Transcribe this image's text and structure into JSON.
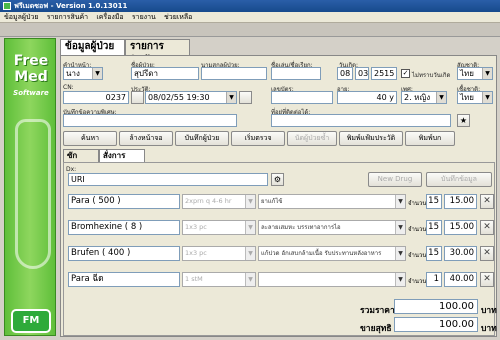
{
  "window": {
    "title": "ฟรีเมดซอฟ - Version 1.0.13011"
  },
  "menu": [
    "ข้อมูลผู้ป่วย",
    "รายการสินค้า",
    "เครื่องมือ",
    "รายงาน",
    "ช่วยเหลือ"
  ],
  "sidebar": {
    "logo_line1": "Free",
    "logo_line2": "Med",
    "logo_line3": "Software",
    "badge": "FM"
  },
  "tabs": {
    "patient": "ข้อมูลผู้ป่วย",
    "products": "รายการสินค้า"
  },
  "patient": {
    "prefix_label": "คำนำหน้า:",
    "prefix": "นาง",
    "firstname_label": "ชื่อผู้ป่วย:",
    "firstname": "สุปรีดา",
    "lastname_label": "นามสกุลผู้ป่วย:",
    "lastname": "",
    "nickname_label": "ชื่อเล่น/ชื่อเรียก:",
    "nickname": "",
    "birthdate_label": "วันเกิด:",
    "birth_day": "08",
    "birth_month": "03",
    "birth_year": "2515",
    "unknown_birth_label": "ไม่ทราบวันเกิด",
    "unknown_birth_checked": "✓",
    "nationality_label": "สัญชาติ:",
    "nationality": "ไทย",
    "cn_label": "CN:",
    "cn": "0237",
    "visit_label": "ประวัติ:",
    "visit_datetime": "08/02/55 19:30",
    "id_label": "เลขบัตร:",
    "id_number": "",
    "age_label": "อายุ:",
    "age": "40 y",
    "sex_label": "เพศ:",
    "sex": "2. หญิง",
    "race_label": "เชื้อชาติ:",
    "race": "ไทย",
    "note_label": "บันทึกข้อความพิเศษ:",
    "note": "",
    "address_label": "ที่อยู่ที่ติดต่อได้:",
    "address": ""
  },
  "actions": {
    "search": "ค้นหา",
    "clear": "ล้างหน้าจอ",
    "save_patient": "บันทึกผู้ป่วย",
    "vitals": "เริ่มตรวจ",
    "appointment": "นัดผู้ป่วยซ้ำ",
    "print_label": "พิมพ์แฟ้มประวัติ",
    "print_receipt": "พิมพ์บก"
  },
  "subtabs": {
    "history": "ซักประวัติ",
    "orders": "สั่งการรักษา"
  },
  "diagnosis": {
    "label": "Dx:",
    "value": "URI"
  },
  "buttons": {
    "new_drug": "New Drug",
    "save_record": "บันทึกข้อมูล"
  },
  "qty_label": "จำนวน",
  "items": [
    {
      "name": "Para ( 500 )",
      "dose": "2xprn q 4-6 hr",
      "note": "ยาแก้ไข้",
      "qty": "15",
      "price": "15.00"
    },
    {
      "name": "Bromhexine ( 8 )",
      "dose": "1x3 pc",
      "note": "ละลายเสมหะ บรรเทาอาการไอ",
      "qty": "15",
      "price": "15.00"
    },
    {
      "name": "Brufen ( 400 )",
      "dose": "1x3 pc",
      "note": "แก้ปวด อักเสบกล้ามเนื้อ รับประทานหลังอาหาร",
      "qty": "15",
      "price": "30.00"
    },
    {
      "name": "Para ฉีด",
      "dose": "1 stM",
      "note": "",
      "qty": "1",
      "price": "40.00"
    }
  ],
  "totals": {
    "total_label": "รวมราคา",
    "total": "100.00",
    "total_unit": "บาท",
    "net_label": "ขายสุทธิ",
    "net": "100.00",
    "net_unit": "บาท"
  }
}
